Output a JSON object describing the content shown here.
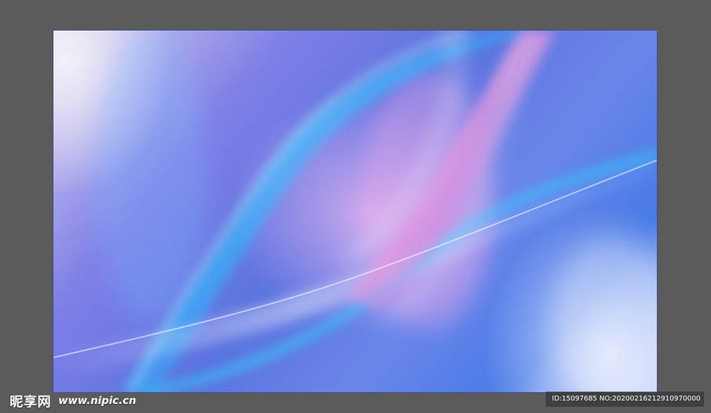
{
  "watermark": {
    "brand_text": "昵享网",
    "site_text": "www.nipic.cn",
    "id_text": "ID:15097685 NO:20200216212910970000"
  },
  "artwork": {
    "colors": {
      "outer_frame": "#5b5b5b",
      "cyan_highlight": "#39d1ff",
      "deep_blue": "#3f69e2",
      "lavender": "#b9b3ef",
      "pink_glow": "#e7a4e8",
      "white_glow": "#ffffff"
    }
  }
}
